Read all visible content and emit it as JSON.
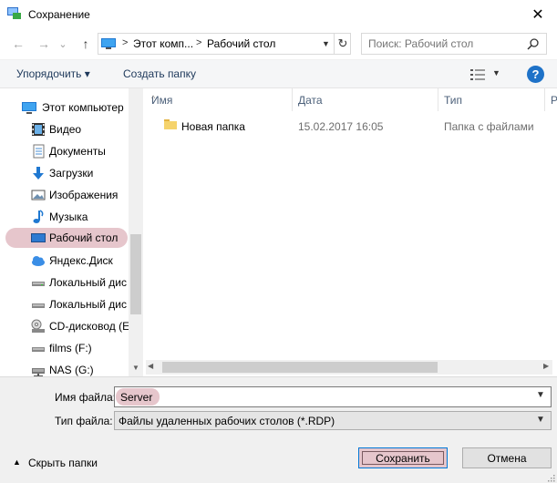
{
  "window": {
    "title": "Сохранение",
    "close_glyph": "✕"
  },
  "nav": {
    "back_glyph": "←",
    "forward_glyph": "→",
    "recent_glyph": "⌄",
    "up_glyph": "↑",
    "breadcrumb": [
      "Этот комп...",
      "Рабочий стол"
    ],
    "crumb_separator": ">",
    "refresh_glyph": "↻"
  },
  "search": {
    "placeholder": "Поиск: Рабочий стол"
  },
  "toolbar": {
    "organize_label": "Упорядочить ▾",
    "new_folder_label": "Создать папку",
    "help_glyph": "?"
  },
  "navpane": {
    "items": [
      {
        "label": "Этот компьютер",
        "icon": "computer-icon",
        "level": "top"
      },
      {
        "label": "Видео",
        "icon": "video-icon",
        "level": "child"
      },
      {
        "label": "Документы",
        "icon": "documents-icon",
        "level": "child"
      },
      {
        "label": "Загрузки",
        "icon": "downloads-icon",
        "level": "child"
      },
      {
        "label": "Изображения",
        "icon": "pictures-icon",
        "level": "child"
      },
      {
        "label": "Музыка",
        "icon": "music-icon",
        "level": "child"
      },
      {
        "label": "Рабочий стол",
        "icon": "desktop-icon",
        "level": "child",
        "selected": true
      },
      {
        "label": "Яндекс.Диск",
        "icon": "cloud-icon",
        "level": "child"
      },
      {
        "label": "Локальный дис",
        "icon": "drive-icon",
        "level": "child"
      },
      {
        "label": "Локальный дис",
        "icon": "drive-icon",
        "level": "child"
      },
      {
        "label": "CD-дисковод (E",
        "icon": "cd-drive-icon",
        "level": "child"
      },
      {
        "label": "films (F:)",
        "icon": "drive-icon",
        "level": "child"
      },
      {
        "label": "NAS (G:)",
        "icon": "network-drive-icon",
        "level": "child"
      }
    ]
  },
  "filelist": {
    "columns": [
      "Имя",
      "Дата",
      "Тип",
      "Р"
    ],
    "sort_glyph": "^",
    "rows": [
      {
        "name": "Новая папка",
        "date": "15.02.2017 16:05",
        "type": "Папка с файлами"
      }
    ]
  },
  "bottom": {
    "filename_label": "Имя файла:",
    "filename_value": "Server",
    "filetype_label": "Тип файла:",
    "filetype_value": "Файлы удаленных рабочих столов (*.RDP)",
    "hide_folders_label": "Скрыть папки",
    "save_label": "Сохранить",
    "cancel_label": "Отмена"
  },
  "colors": {
    "highlight": "#e6c6cc",
    "accent": "#0078d7",
    "folder": "#f5d36c"
  }
}
